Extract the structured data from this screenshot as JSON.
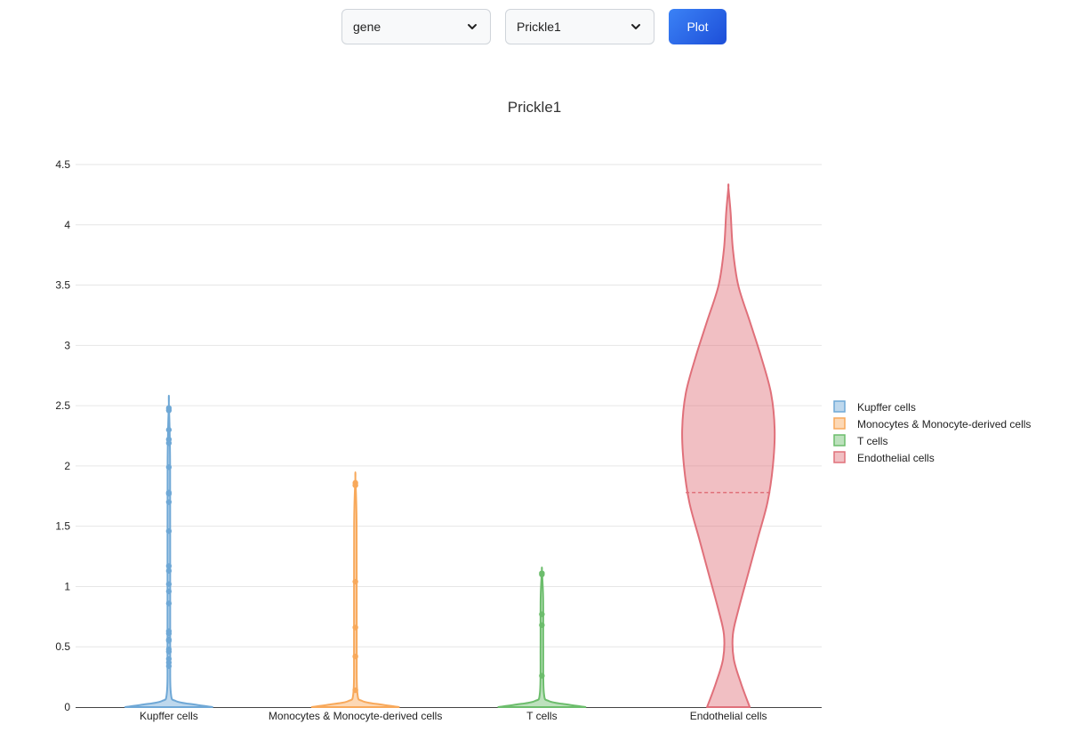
{
  "controls": {
    "category_select": {
      "value": "gene"
    },
    "gene_select": {
      "value": "Prickle1"
    },
    "plot_button": {
      "label": "Plot"
    }
  },
  "chart_data": {
    "type": "violin",
    "title": "Prickle1",
    "xlabel": "",
    "ylabel": "",
    "ylim": [
      0,
      4.5
    ],
    "yticks": [
      0,
      0.5,
      1,
      1.5,
      2,
      2.5,
      3,
      3.5,
      4,
      4.5
    ],
    "grid": true,
    "legend_position": "right",
    "categories": [
      "Kupffer cells",
      "Monocytes & Monocyte-derived cells",
      "T cells",
      "Endothelial cells"
    ],
    "series": [
      {
        "name": "Kupffer cells",
        "color": "#6fa8d6",
        "max": 2.52,
        "median": 0,
        "points": [
          2.48,
          2.46,
          2.3,
          2.22,
          2.19,
          1.99,
          1.78,
          1.77,
          1.7,
          1.46,
          1.17,
          1.13,
          1.02,
          0.96,
          0.86,
          0.63,
          0.61,
          0.56,
          0.55,
          0.48,
          0.46,
          0.4,
          0.37,
          0.34
        ]
      },
      {
        "name": "Monocytes & Monocyte-derived cells",
        "color": "#f8a95b",
        "max": 1.9,
        "median": 0,
        "points": [
          1.86,
          1.84,
          1.04,
          0.66,
          0.42,
          0.14
        ]
      },
      {
        "name": "T cells",
        "color": "#6cbd6c",
        "max": 1.13,
        "median": 0,
        "points": [
          1.11,
          1.1,
          0.77,
          0.68,
          0.26
        ]
      },
      {
        "name": "Endothelial cells",
        "color": "#e0707a",
        "max": 4.31,
        "median": 1.78,
        "points": []
      }
    ]
  }
}
